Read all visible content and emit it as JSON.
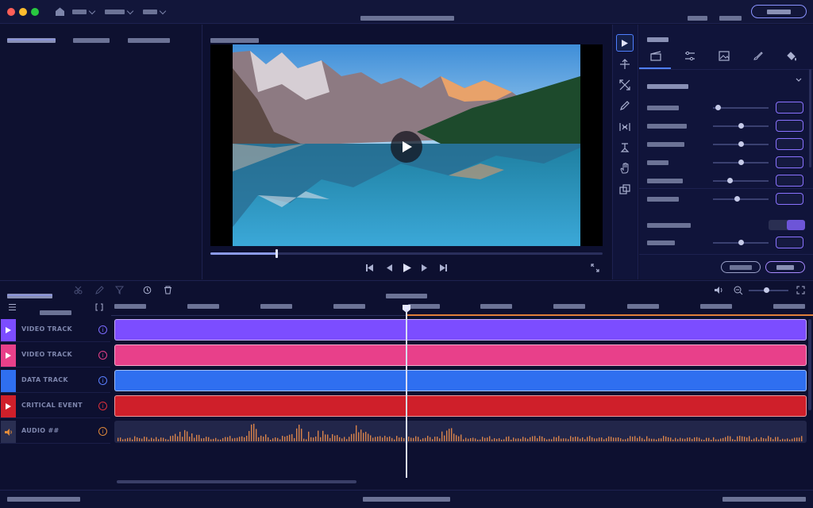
{
  "titlebar": {
    "traffic_lights": {
      "close": "#ff5f57",
      "minimize": "#febc2e",
      "zoom": "#28c840"
    },
    "home_icon": "home-icon"
  },
  "timeline": {
    "tracks": [
      {
        "name": "VIDEO TRACK",
        "color": "#7c4dff",
        "icon": "play-icon",
        "info_color": "#7c6bff"
      },
      {
        "name": "VIDEO TRACK",
        "color": "#e8408a",
        "icon": "play-icon",
        "info_color": "#e8408a"
      },
      {
        "name": "DATA TRACK",
        "color": "#2f6ff0",
        "icon": "",
        "info_color": "#5a7fff"
      },
      {
        "name": "CRITICAL EVENT",
        "color": "#cf1f2a",
        "icon": "play-icon",
        "info_color": "#e0303c"
      },
      {
        "name": "AUDIO ##",
        "color": "#2a2f52",
        "icon": "speaker-icon",
        "info_color": "#e08a3a"
      }
    ],
    "playhead_position": 0.42
  },
  "player": {
    "progress": 0.17
  },
  "colors": {
    "accent": "#4f7fff",
    "accent_purple": "#8a72ff",
    "background": "#0f1230"
  }
}
